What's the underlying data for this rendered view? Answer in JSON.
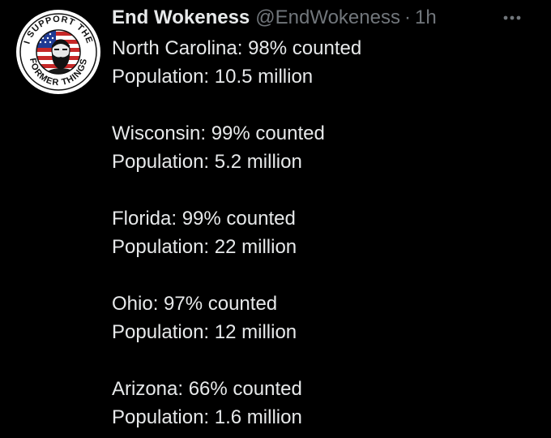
{
  "tweet": {
    "author": {
      "display_name": "End Wokeness",
      "handle": "@EndWokeness",
      "separator": "·",
      "timestamp": "1h",
      "avatar": {
        "icon": "avatar-badge-icon",
        "text_top": "I SUPPORT THE",
        "text_bottom": "FORMER THINGS"
      }
    },
    "more_icon": "more-options-icon",
    "states": [
      {
        "counted": "North Carolina: 98% counted",
        "population": "Population: 10.5 million"
      },
      {
        "counted": "Wisconsin: 99% counted",
        "population": "Population: 5.2 million"
      },
      {
        "counted": "Florida: 99% counted",
        "population": "Population: 22 million"
      },
      {
        "counted": "Ohio: 97% counted",
        "population": "Population: 12 million"
      },
      {
        "counted": "Arizona: 66% counted",
        "population": "Population: 1.6 million"
      }
    ]
  },
  "colors": {
    "background": "#000000",
    "primary_text": "#e7e9ea",
    "secondary_text": "#71767b",
    "avatar_red": "#c62828",
    "avatar_blue": "#1f3a93"
  }
}
